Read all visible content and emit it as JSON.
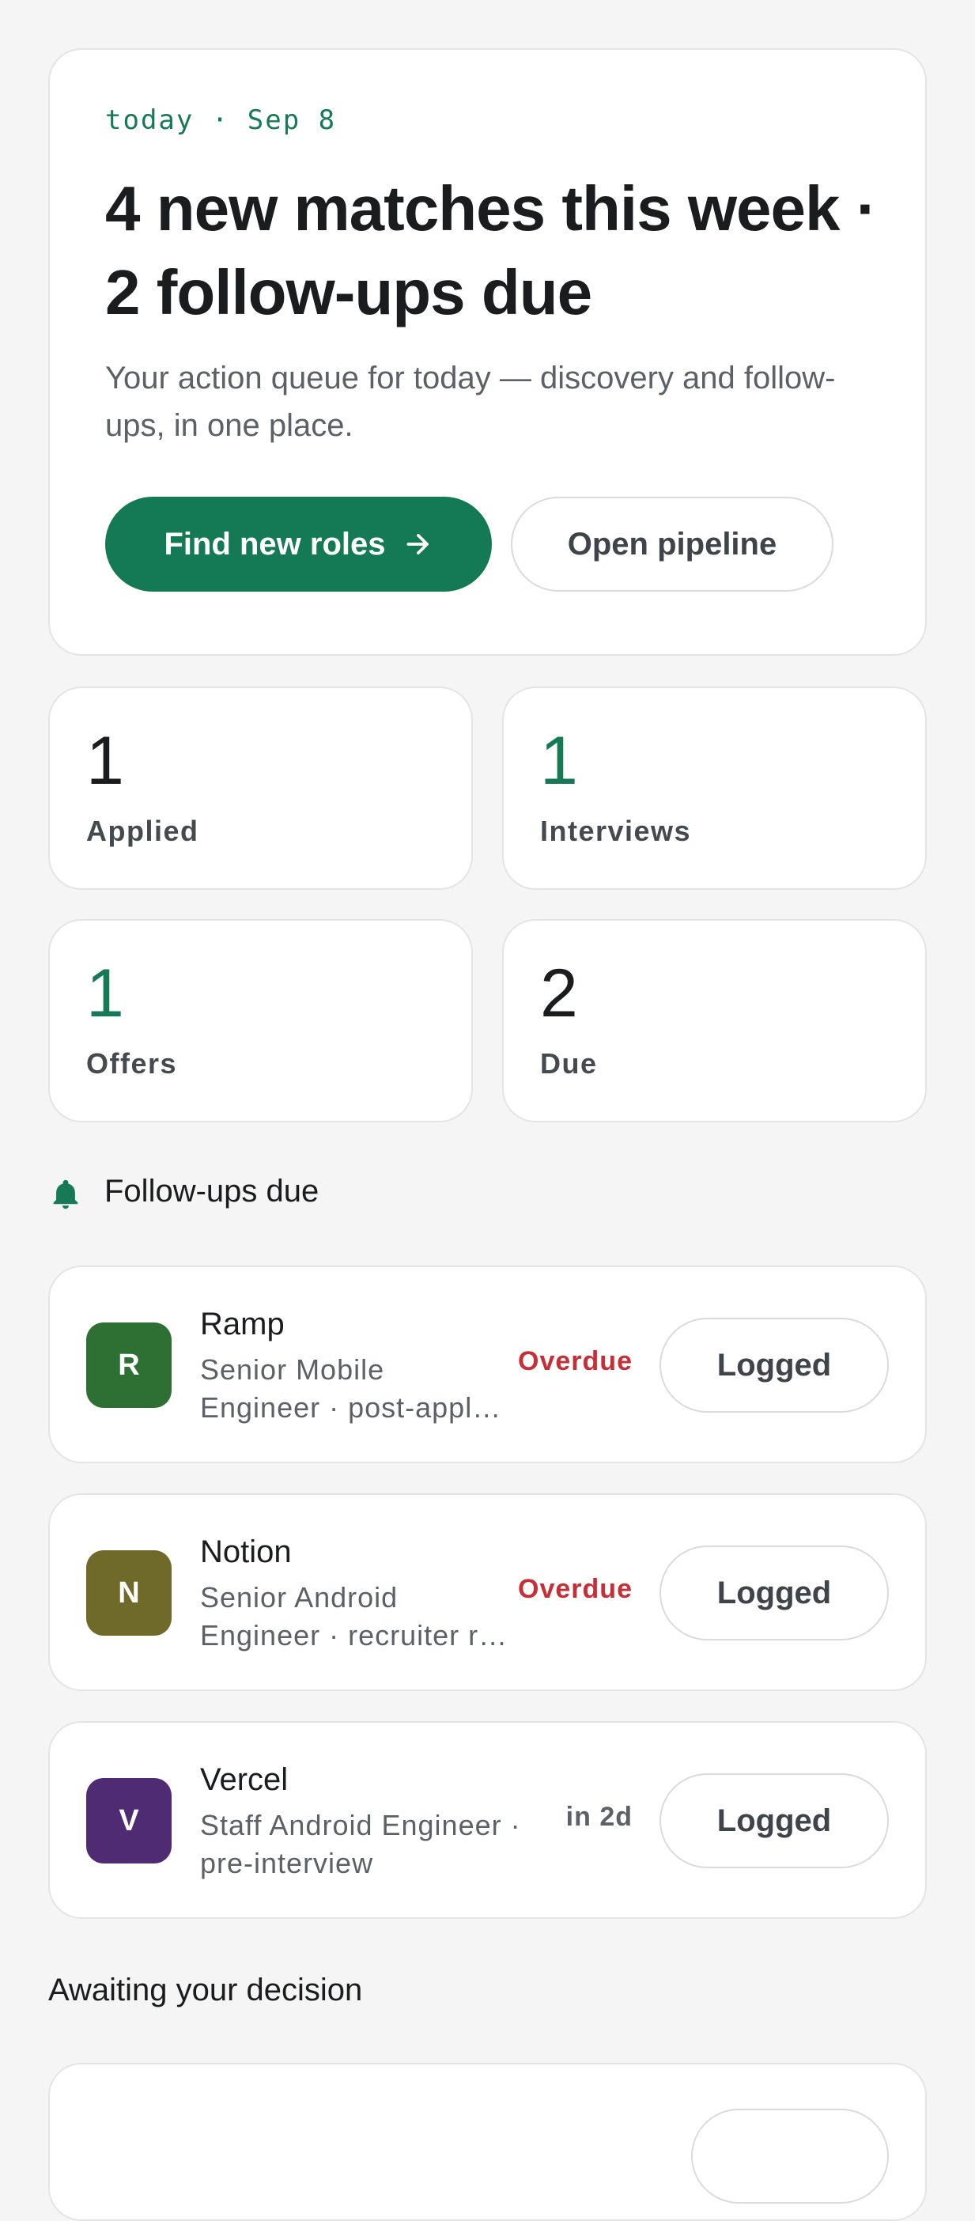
{
  "hero": {
    "date": "today · Sep 8",
    "headline": "4 new matches this week · 2 follow-ups due",
    "subtitle": "Your action queue for today — discovery and follow-ups, in one place.",
    "primary_button": "Find new roles",
    "secondary_button": "Open pipeline"
  },
  "stats": [
    {
      "value": "1",
      "label": "Applied",
      "accent": false
    },
    {
      "value": "1",
      "label": "Interviews",
      "accent": true
    },
    {
      "value": "1",
      "label": "Offers",
      "accent": true
    },
    {
      "value": "2",
      "label": "Due",
      "accent": false
    }
  ],
  "followups": {
    "title": "Follow-ups due",
    "items": [
      {
        "initial": "R",
        "company": "Ramp",
        "line1": "Senior Mobile",
        "line2": "Engineer · post-appl…",
        "status": "Overdue",
        "button": "Logged",
        "color": "#2e7034"
      },
      {
        "initial": "N",
        "company": "Notion",
        "line1": "Senior Android",
        "line2": "Engineer · recruiter r…",
        "status": "Overdue",
        "button": "Logged",
        "color": "#706a2a"
      },
      {
        "initial": "V",
        "company": "Vercel",
        "line1": "Staff Android Engineer ·",
        "line2": "pre-interview",
        "status": "in 2d",
        "button": "Logged",
        "color": "#4e2b72"
      }
    ]
  },
  "awaiting": {
    "title": "Awaiting your decision"
  },
  "colors": {
    "accent": "#137a55",
    "overdue": "#c62f35",
    "background": "#f4f5f4"
  }
}
